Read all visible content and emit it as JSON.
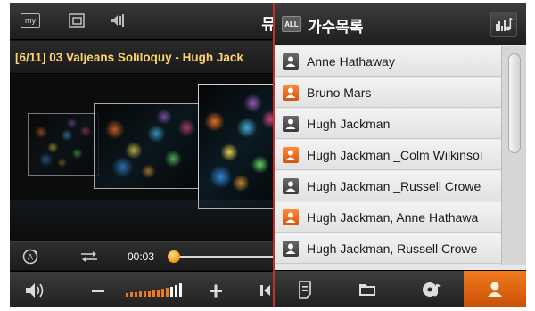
{
  "player": {
    "top_buttons": [
      {
        "name": "my-button",
        "label": "my"
      },
      {
        "name": "window-button",
        "label": ""
      },
      {
        "name": "music-settings-button",
        "label": ""
      }
    ],
    "title_partial": "뮤",
    "now_playing": "[6/11] 03 Valjeans Soliloquy - Hugh Jack",
    "elapsed": "00:03",
    "progress_fraction": 0.02
  },
  "panel": {
    "all_label": "ALL",
    "title": "가수목록",
    "artists": [
      {
        "name": "Anne Hathaway",
        "icon": "gray"
      },
      {
        "name": "Bruno Mars",
        "icon": "orange"
      },
      {
        "name": "Hugh Jackman",
        "icon": "gray"
      },
      {
        "name": "Hugh Jackman _Colm Wilkinsoı",
        "icon": "orange"
      },
      {
        "name": "Hugh Jackman _Russell Crowe",
        "icon": "gray"
      },
      {
        "name": "Hugh Jackman, Anne Hathawa",
        "icon": "orange"
      },
      {
        "name": "Hugh Jackman, Russell Crowe",
        "icon": "gray"
      }
    ],
    "bottom_tabs": [
      "document-icon",
      "folder-icon",
      "album-icon",
      "artist-icon"
    ],
    "active_tab": 3
  },
  "colors": {
    "accent": "#e8701a",
    "now_playing_text": "#ffd46a",
    "divider": "#c4302b"
  }
}
